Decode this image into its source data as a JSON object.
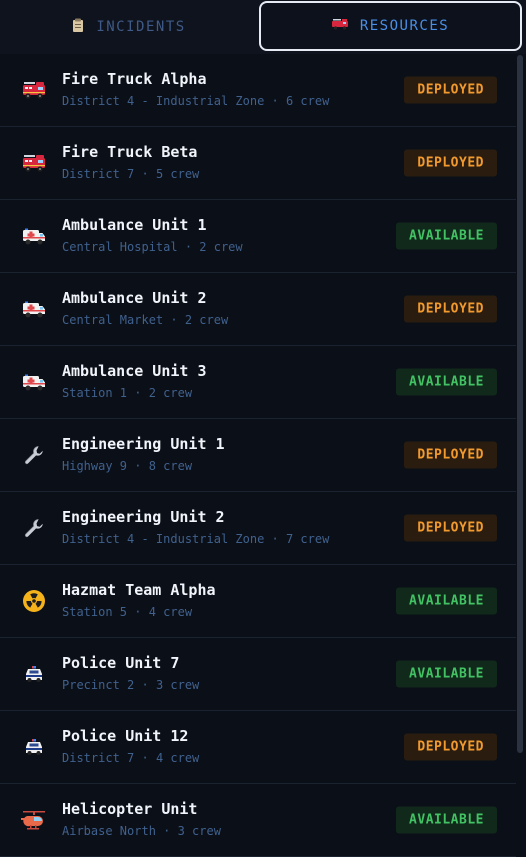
{
  "tabs": [
    {
      "label": "INCIDENTS",
      "icon": "clipboard-icon",
      "active": false
    },
    {
      "label": "RESOURCES",
      "icon": "fire-engine-icon",
      "active": true
    }
  ],
  "resources": [
    {
      "name": "Fire Truck Alpha",
      "location": "District 4 - Industrial Zone",
      "crew": "6 crew",
      "status": "DEPLOYED",
      "icon": "fire-engine-icon"
    },
    {
      "name": "Fire Truck Beta",
      "location": "District 7",
      "crew": "5 crew",
      "status": "DEPLOYED",
      "icon": "fire-engine-icon"
    },
    {
      "name": "Ambulance Unit 1",
      "location": "Central Hospital",
      "crew": "2 crew",
      "status": "AVAILABLE",
      "icon": "ambulance-icon"
    },
    {
      "name": "Ambulance Unit 2",
      "location": "Central Market",
      "crew": "2 crew",
      "status": "DEPLOYED",
      "icon": "ambulance-icon"
    },
    {
      "name": "Ambulance Unit 3",
      "location": "Station 1",
      "crew": "2 crew",
      "status": "AVAILABLE",
      "icon": "ambulance-icon"
    },
    {
      "name": "Engineering Unit 1",
      "location": "Highway 9",
      "crew": "8 crew",
      "status": "DEPLOYED",
      "icon": "wrench-icon"
    },
    {
      "name": "Engineering Unit 2",
      "location": "District 4 - Industrial Zone",
      "crew": "7 crew",
      "status": "DEPLOYED",
      "icon": "wrench-icon"
    },
    {
      "name": "Hazmat Team Alpha",
      "location": "Station 5",
      "crew": "4 crew",
      "status": "AVAILABLE",
      "icon": "radioactive-icon"
    },
    {
      "name": "Police Unit 7",
      "location": "Precinct 2",
      "crew": "3 crew",
      "status": "AVAILABLE",
      "icon": "police-car-icon"
    },
    {
      "name": "Police Unit 12",
      "location": "District 7",
      "crew": "4 crew",
      "status": "DEPLOYED",
      "icon": "police-car-icon"
    },
    {
      "name": "Helicopter Unit",
      "location": "Airbase North",
      "crew": "3 crew",
      "status": "AVAILABLE",
      "icon": "helicopter-icon"
    }
  ],
  "colors": {
    "background": "#0b0f17",
    "deployed": "#f29a2e",
    "available": "#43c264",
    "accent": "#4a8fe8"
  }
}
